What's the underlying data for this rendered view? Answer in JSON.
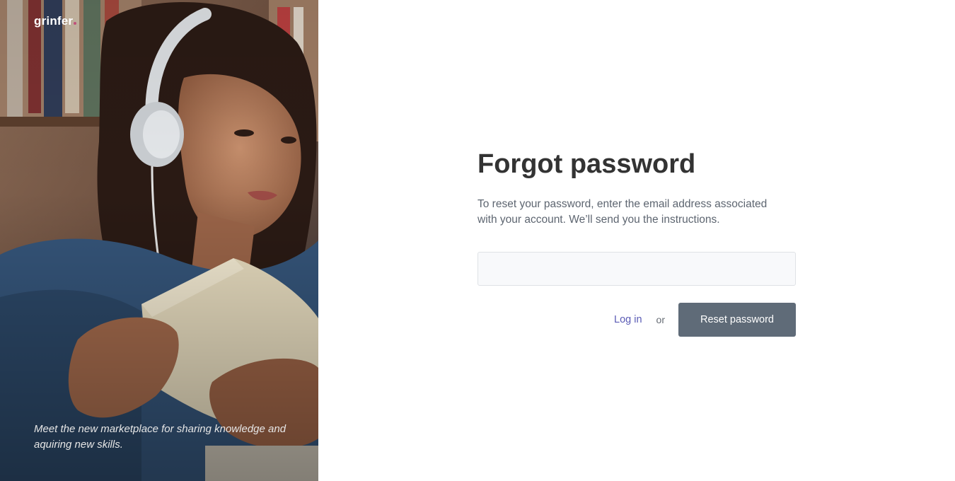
{
  "brand": {
    "name": "grinfer",
    "dot_color": "#c0507a"
  },
  "hero": {
    "tagline": "Meet the new marketplace for sharing knowledge and aquiring new skills.",
    "image_description_icon": "photo-illustration"
  },
  "form": {
    "title": "Forgot password",
    "description": "To reset your password, enter the email address associated with your account. We’ll send you the instructions.",
    "email": {
      "value": "",
      "placeholder": ""
    },
    "login_label": "Log in",
    "or_label": "or",
    "reset_label": "Reset password"
  },
  "colors": {
    "title": "#333333",
    "link": "#5a5bb5",
    "button_bg": "#5f6b78",
    "input_bg": "#f8f9fb"
  }
}
